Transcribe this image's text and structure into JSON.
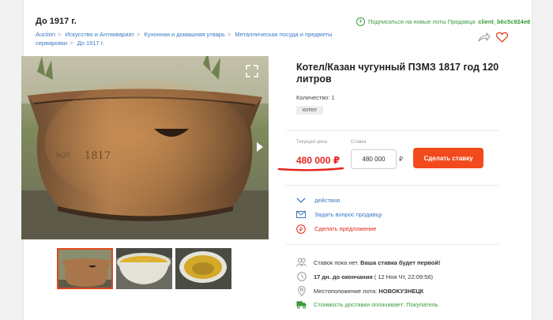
{
  "header": {
    "category_title": "До 1917 г.",
    "breadcrumbs": [
      "Auction",
      "Искусство и Антиквариат",
      "Кухонная и домашняя утварь",
      "Металлическая посуда и предметы сервировки",
      "До 1917 г."
    ],
    "subscribe_text": "Подписаться на новые лоты Продавца",
    "seller_name": "client_b6c5c924e8"
  },
  "icons": {
    "subscribe": "plus-circle-icon",
    "share": "share-icon",
    "favorite": "heart-icon",
    "expand": "expand-icon",
    "next": "next-arrow-icon",
    "actions": [
      "chevron-down-icon",
      "envelope-icon",
      "ruble-circle-icon"
    ],
    "info": [
      "people-icon",
      "clock-icon",
      "location-pin-icon",
      "truck-icon"
    ]
  },
  "lot": {
    "title": "Котел/Казан чугунный ПЗМЗ 1817 год 120 литров",
    "quantity": "Количество: 1",
    "tag": "котел",
    "current_price_label": "Текущая цена",
    "current_price": "480 000 ₽",
    "bid_label": "Ставка",
    "bid_value": "480 000",
    "bid_currency": "₽",
    "bid_button": "Сделать ставку"
  },
  "actions": [
    {
      "label": "действия"
    },
    {
      "label": "Задать вопрос продавцу"
    },
    {
      "label": "Сделать предложение"
    }
  ],
  "info": {
    "bids_text": "Ставок пока нет.",
    "bids_strong": "Ваша ставка будет первой!",
    "end_strong": "17 дн. до окончания",
    "end_date": "( 12 Ноя Чт, 22:09:56)",
    "location_label": "Местоположение лота:",
    "location_value": "НОВОКУЗНЕЦК",
    "delivery": "Стоимость доставки оплачивает: Покупатель"
  },
  "colors": {
    "accent": "#f24a1d",
    "price": "#e4261e",
    "link": "#3a78c3",
    "green": "#3a9a3a"
  }
}
